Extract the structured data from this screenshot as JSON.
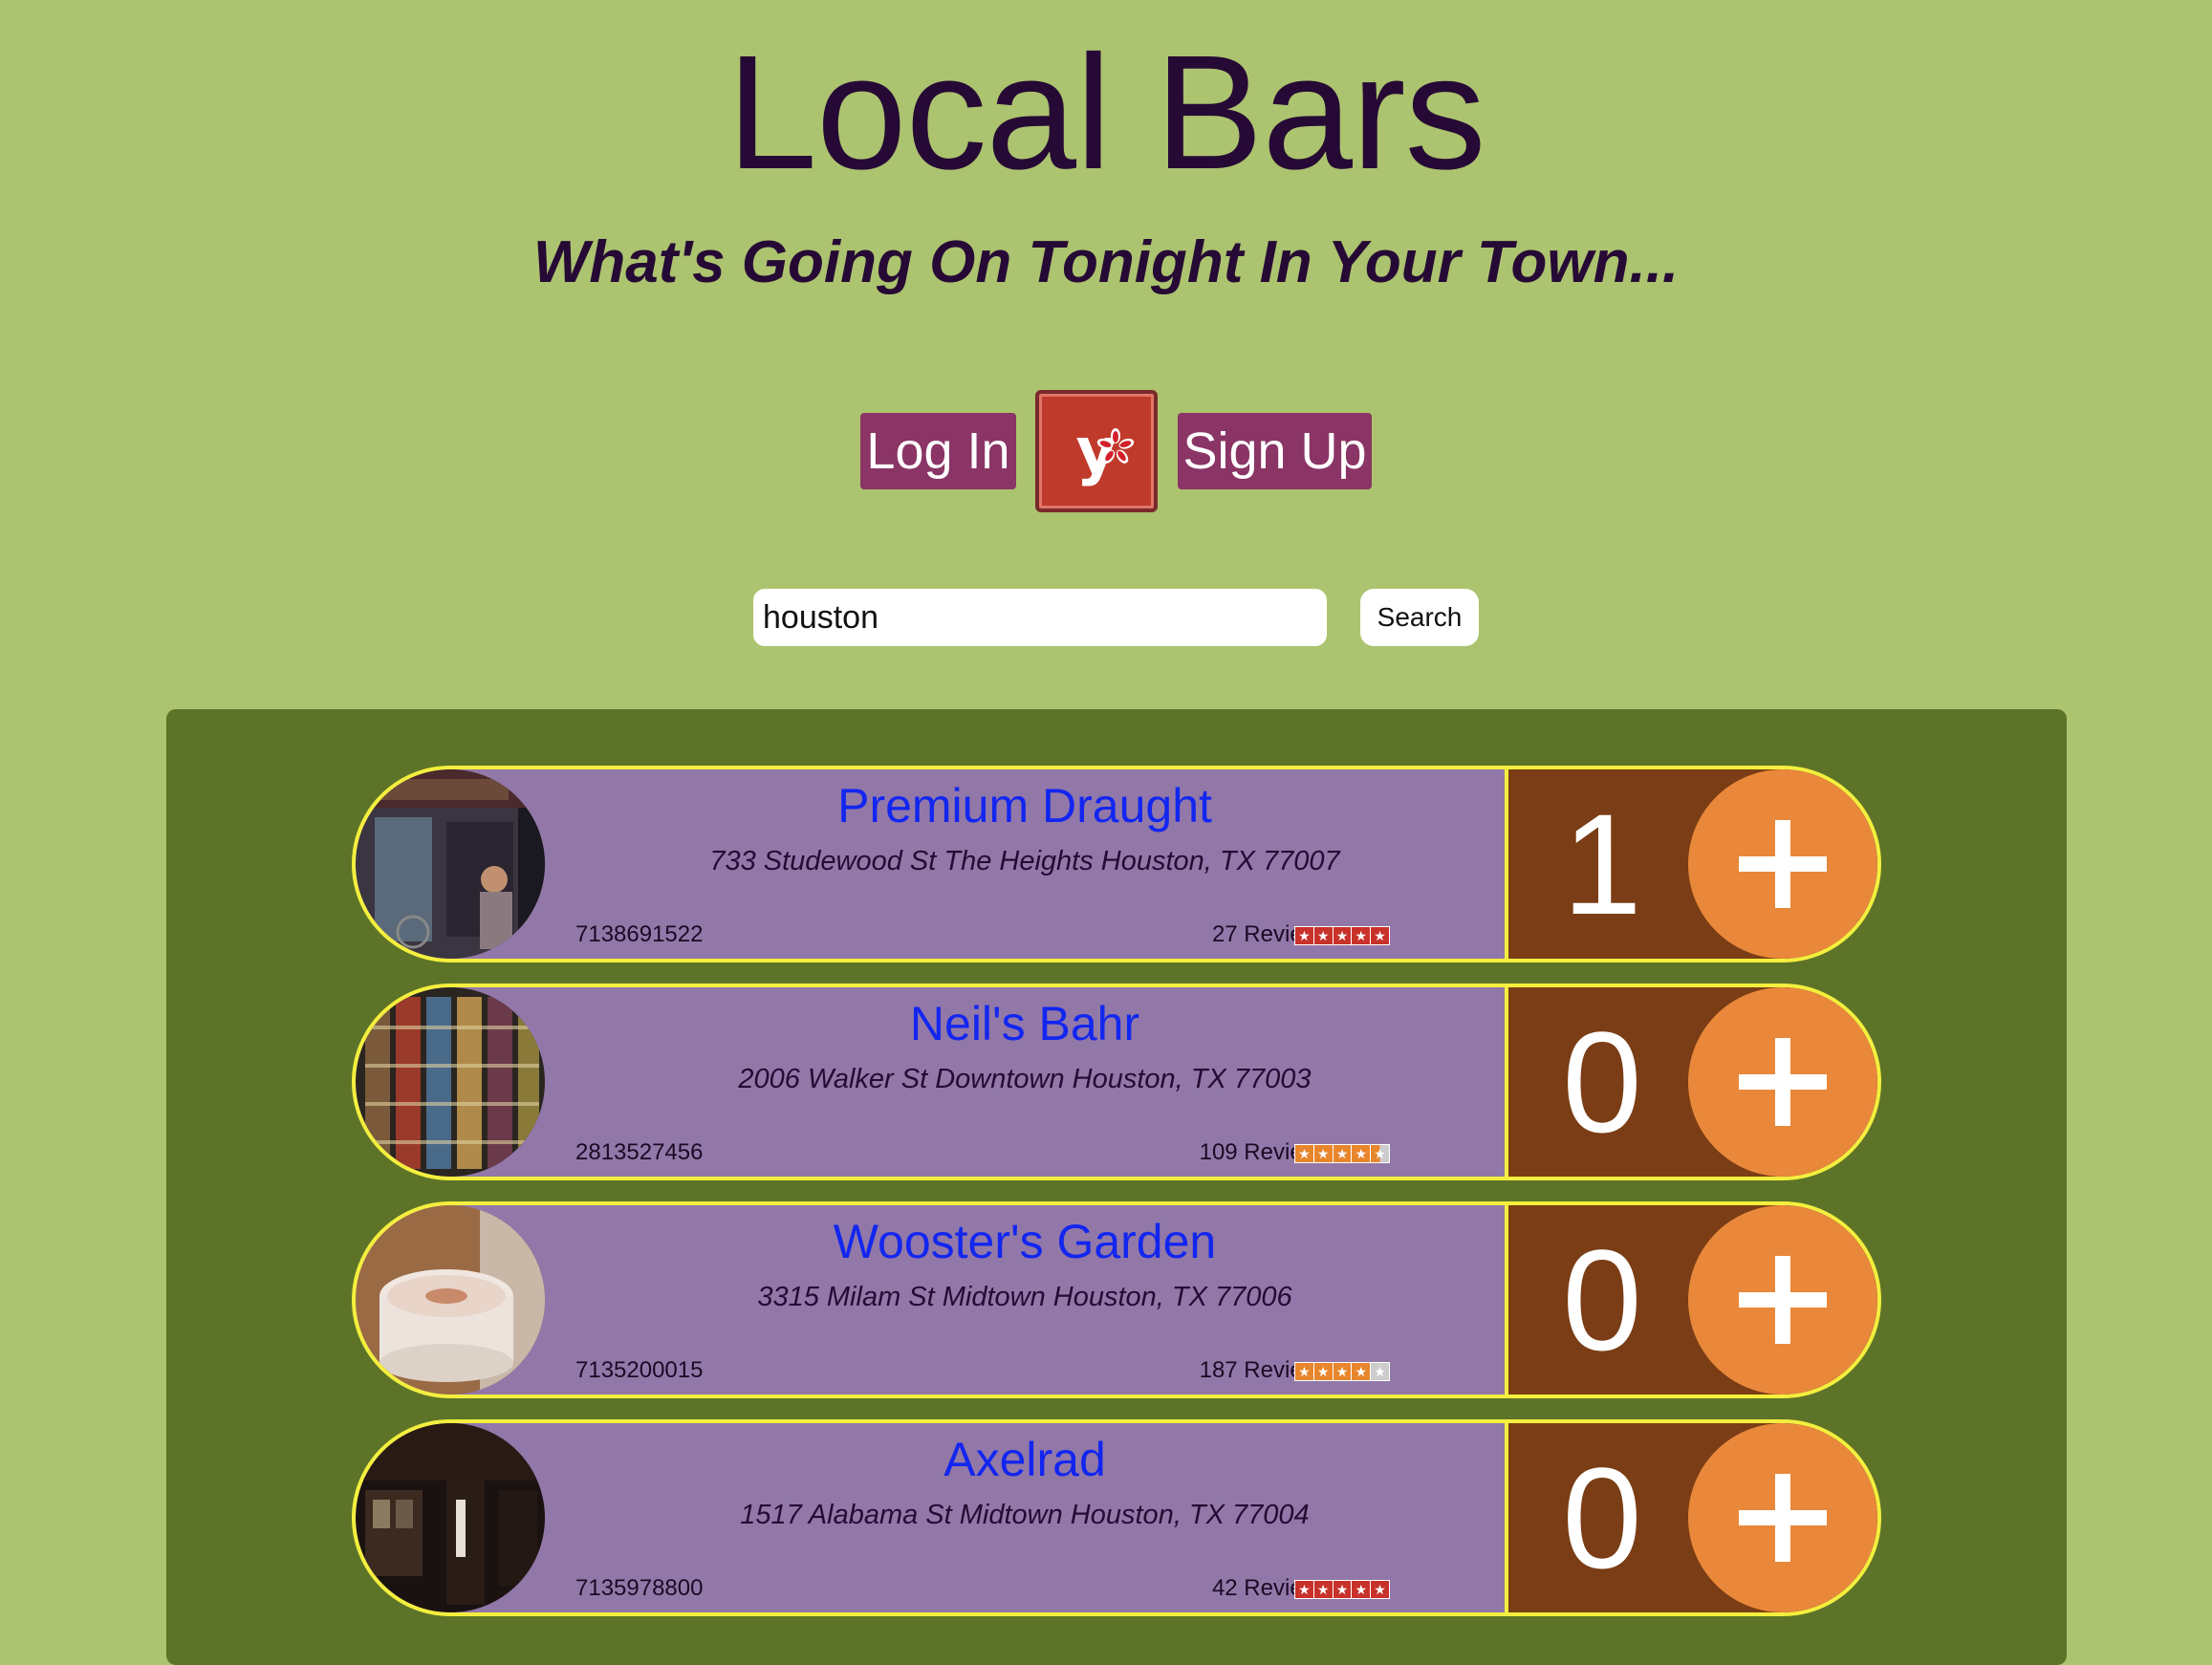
{
  "header": {
    "title": "Local Bars",
    "subtitle": "What's Going On Tonight In Your Town..."
  },
  "auth": {
    "login_label": "Log In",
    "yelp_label": "y",
    "signup_label": "Sign Up"
  },
  "search": {
    "value": "houston",
    "button_label": "Search"
  },
  "colors": {
    "background": "#acc36f",
    "panel": "#5d7428",
    "card": "#9278a8",
    "card_border": "#f4ef3e",
    "counter_bg": "#7a3d15",
    "add_button": "#e9883a",
    "bar_name": "#1226f0",
    "yelp_red": "#c03a2b",
    "auth_button": "#8a3566"
  },
  "bars": [
    {
      "name": "Premium Draught",
      "address": "733 Studewood St The Heights Houston, TX 77007",
      "phone": "7138691522",
      "reviews": "27 Reviews",
      "rating": 5,
      "star_color": "#c8322a",
      "going": "1",
      "photo": "storefront-photo"
    },
    {
      "name": "Neil's Bahr",
      "address": "2006 Walker St Downtown Houston, TX 77003",
      "phone": "2813527456",
      "reviews": "109 Reviews",
      "rating": 4.5,
      "star_color": "#e8862d",
      "going": "0",
      "photo": "comics-wall-photo"
    },
    {
      "name": "Wooster's Garden",
      "address": "3315 Milam St Midtown Houston, TX 77006",
      "phone": "7135200015",
      "reviews": "187 Reviews",
      "rating": 4,
      "star_color": "#e8862d",
      "going": "0",
      "photo": "latte-photo"
    },
    {
      "name": "Axelrad",
      "address": "1517 Alabama St Midtown Houston, TX 77004",
      "phone": "7135978800",
      "reviews": "42 Reviews",
      "rating": 5,
      "star_color": "#c8322a",
      "going": "0",
      "photo": "night-bar-photo"
    }
  ]
}
